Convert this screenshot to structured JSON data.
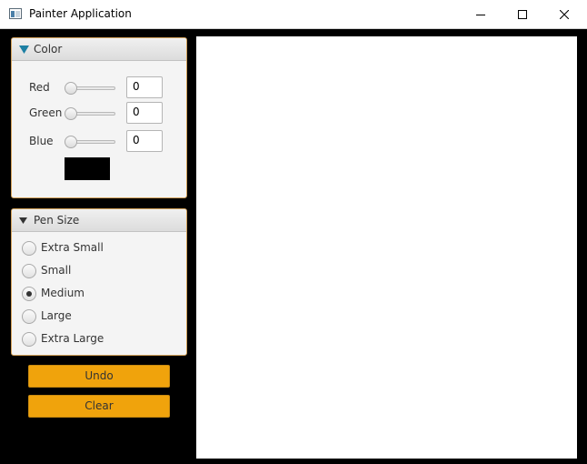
{
  "window": {
    "title": "Painter Application"
  },
  "icons": {
    "app": "app-window-icon",
    "minimize": "minimize-icon",
    "maximize": "maximize-icon",
    "close": "close-icon",
    "pane_toggle": "triangle-down-icon"
  },
  "color_pane": {
    "title": "Color",
    "red": {
      "label": "Red",
      "value": "0",
      "level": 0
    },
    "green": {
      "label": "Green",
      "value": "0",
      "level": 0
    },
    "blue": {
      "label": "Blue",
      "value": "0",
      "level": 0
    },
    "preview_color": "#000000"
  },
  "pen_pane": {
    "title": "Pen Size",
    "options": [
      {
        "label": "Extra Small",
        "selected": false
      },
      {
        "label": "Small",
        "selected": false
      },
      {
        "label": "Medium",
        "selected": true
      },
      {
        "label": "Large",
        "selected": false
      },
      {
        "label": "Extra Large",
        "selected": false
      }
    ]
  },
  "buttons": {
    "undo": "Undo",
    "clear": "Clear"
  },
  "colors": {
    "accent_button": "#f0a30c",
    "pane_border": "#d2a15a",
    "background": "#000000",
    "canvas": "#ffffff"
  }
}
